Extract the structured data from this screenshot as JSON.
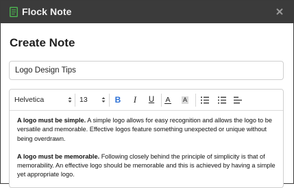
{
  "window": {
    "title": "Flock Note",
    "icon": "note-icon",
    "close_icon": "close-icon"
  },
  "page": {
    "title": "Create Note"
  },
  "note_title_input": {
    "value": "Logo Design Tips"
  },
  "toolbar": {
    "font_family": "Helvetica",
    "font_size": "13",
    "bold_label": "B",
    "italic_label": "I",
    "underline_label": "U",
    "text_color_label": "A",
    "highlight_label": "A",
    "icons": [
      "numbered-list-icon",
      "bulleted-list-icon",
      "align-left-icon"
    ],
    "colors": {
      "bold_active": "#2a6fd6",
      "highlight_bg": "#d9d9d9"
    }
  },
  "content": {
    "paragraphs": [
      {
        "lead": "A logo must be simple.",
        "text": " A simple logo allows for easy recognition and allows the logo to be versatile and memorable. Effective logos feature something unexpected or unique without being overdrawn."
      },
      {
        "lead": "A logo must be memorable.",
        "text": " Following closely behind the principle of simplicity is that of memorability. An effective logo should be memorable and this is achieved by having a simple yet appropriate logo."
      }
    ]
  },
  "colors": {
    "titlebar_bg": "#3b3b3b",
    "app_icon": "#4caf50"
  }
}
